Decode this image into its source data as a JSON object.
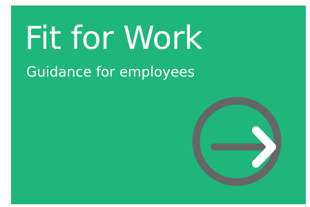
{
  "card": {
    "title": "Fit for Work",
    "subtitle": "Guidance for employees",
    "icon": "arrow-right-circle-icon",
    "background_color": "#1EB67B",
    "text_color": "#FFFFFF",
    "icon_ring_color": "#666666",
    "icon_arrow_color": "#FFFFFF"
  }
}
